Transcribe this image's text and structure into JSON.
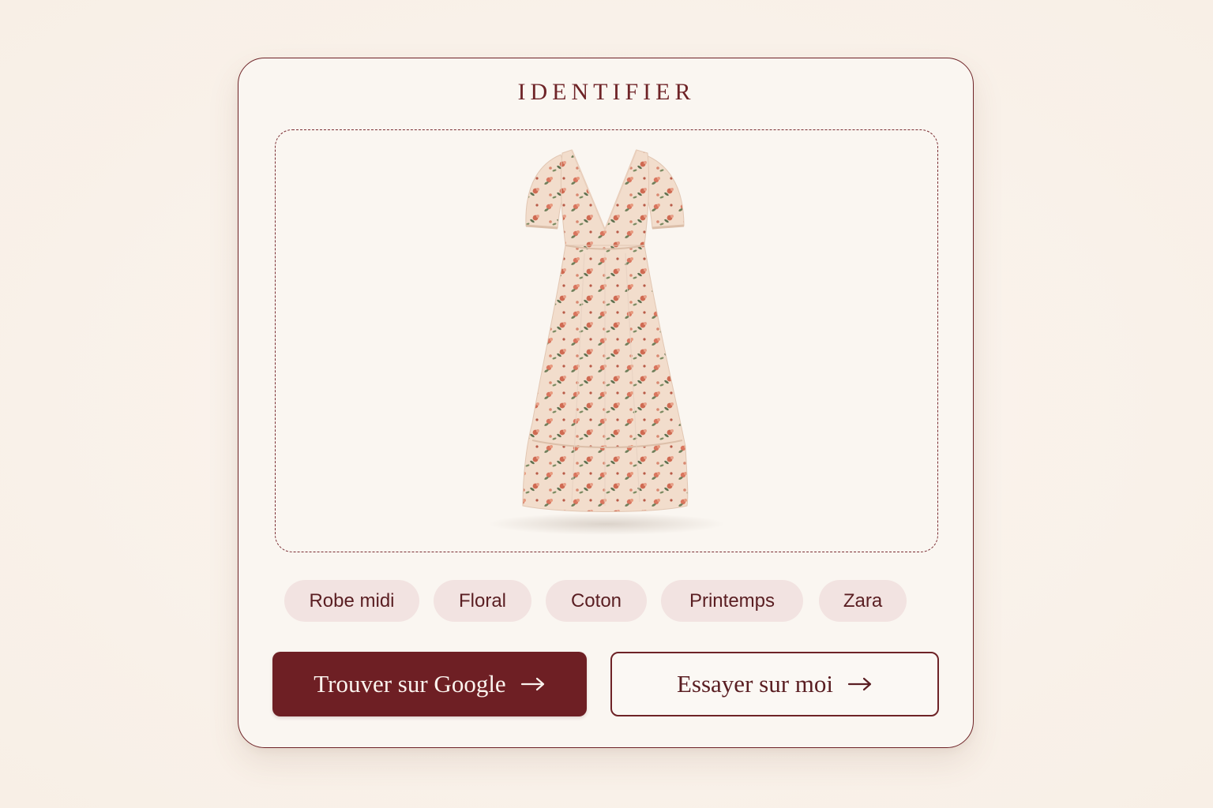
{
  "title": "IDENTIFIER",
  "image": {
    "icon": "floral-midi-dress-image"
  },
  "tags": [
    "Robe midi",
    "Floral",
    "Coton",
    "Printemps",
    "Zara"
  ],
  "actions": {
    "primary_label": "Trouver sur Google",
    "secondary_label": "Essayer sur moi",
    "arrow_icon": "arrow-right-icon"
  },
  "colors": {
    "accent": "#6e1f24",
    "tag_bg": "#f2e3e1",
    "card_bg": "#faf6f1",
    "page_bg": "#f9f1ea"
  }
}
